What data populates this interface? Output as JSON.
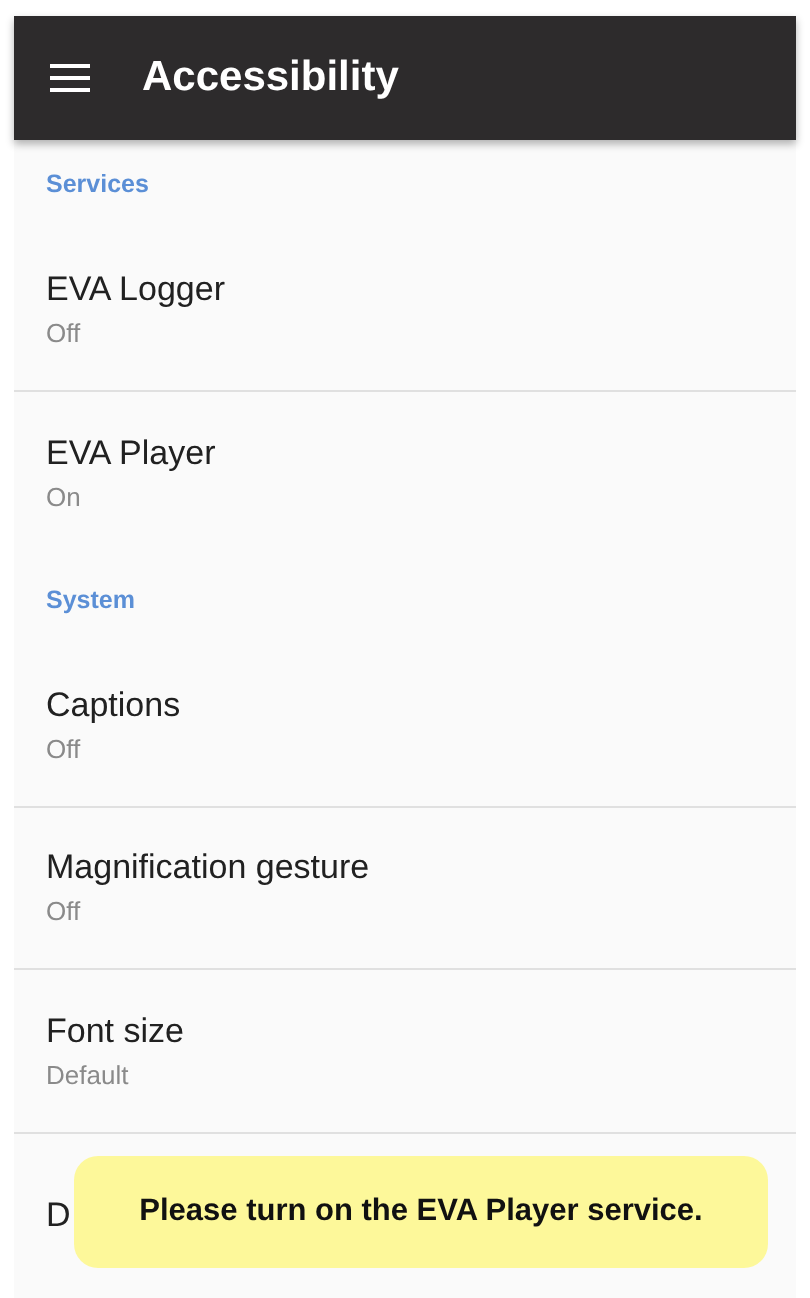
{
  "app_bar": {
    "title": "Accessibility"
  },
  "sections": [
    {
      "header": "Services",
      "items": [
        {
          "title": "EVA Logger",
          "summary": "Off"
        },
        {
          "title": "EVA Player",
          "summary": "On"
        }
      ]
    },
    {
      "header": "System",
      "items": [
        {
          "title": "Captions",
          "summary": "Off"
        },
        {
          "title": "Magnification gesture",
          "summary": "Off"
        },
        {
          "title": "Font size",
          "summary": "Default"
        },
        {
          "title": "D"
        }
      ]
    }
  ],
  "toast": {
    "message": "Please turn on the EVA Player service."
  }
}
